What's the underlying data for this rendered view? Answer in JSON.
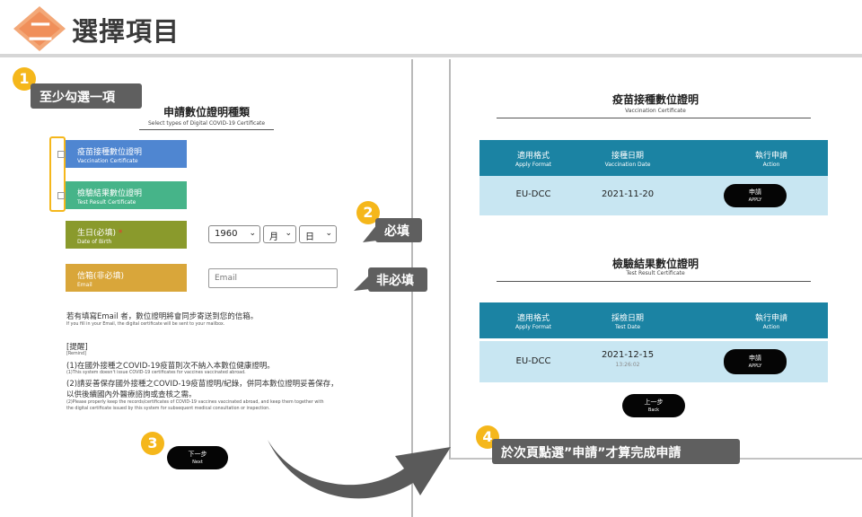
{
  "header": {
    "step_number": "二",
    "title": "選擇項目"
  },
  "form": {
    "title": "申請數位證明種類",
    "subtitle": "Select types of Digital COVID-19 Certificate",
    "options": [
      {
        "zh": "疫苗接種數位證明",
        "en": "Vaccination Certificate"
      },
      {
        "zh": "檢驗結果數位證明",
        "en": "Test Result Certificate"
      }
    ],
    "dob": {
      "zh": "生日(必填)",
      "required_mark": "*",
      "en": "Date of Birth",
      "year": "1960",
      "month": "月",
      "day": "日"
    },
    "email": {
      "zh": "信箱(非必填)",
      "en": "Email",
      "placeholder": "Email"
    },
    "notes": [
      {
        "zh": "若有填寫Email 者，數位證明將會同步寄送到您的信箱。",
        "en": "If you fill in your Email, the digital certificate will be sent to your mailbox."
      },
      {
        "zh": "[提醒]",
        "en": "[Remind]"
      },
      {
        "zh": "(1)在國外接種之COVID-19疫苗則次不納入本數位健康證明。",
        "en": "(1)This system doesn't issue COVID-19 certificates for vaccines vaccinated abroad."
      },
      {
        "zh": "(2)請妥善保存國外接種之COVID-19疫苗證明/紀錄，併同本數位證明妥善保存，",
        "zh2": "以供後續國內外醫療諮詢或查核之需。",
        "en": "(2)Please properly keep the records/certificates of COVID-19 vaccines vaccinated abroad, and keep them together with",
        "en2": "the digital certificate issued by this system for subsequent medical consultation or inspection."
      }
    ],
    "next_button": {
      "zh": "下一步",
      "en": "Next"
    }
  },
  "right": {
    "vaccination": {
      "title": "疫苗接種數位證明",
      "subtitle": "Vaccination Certificate",
      "headers": [
        {
          "zh": "適用格式",
          "en": "Apply Format"
        },
        {
          "zh": "接種日期",
          "en": "Vaccination Date"
        },
        {
          "zh": "執行申請",
          "en": "Action"
        }
      ],
      "row": {
        "format": "EU-DCC",
        "date": "2021-11-20"
      }
    },
    "test": {
      "title": "檢驗結果數位證明",
      "subtitle": "Test Result Certificate",
      "headers": [
        {
          "zh": "適用格式",
          "en": "Apply Format"
        },
        {
          "zh": "採檢日期",
          "en": "Test Date"
        },
        {
          "zh": "執行申請",
          "en": "Action"
        }
      ],
      "row": {
        "format": "EU-DCC",
        "date": "2021-12-15",
        "time": "13:26:02"
      }
    },
    "apply_button": {
      "zh": "申請",
      "en": "APPLY"
    },
    "back_button": {
      "zh": "上一步",
      "en": "Back"
    }
  },
  "callouts": [
    {
      "number": "1",
      "text": "至少勾選一項"
    },
    {
      "number": "2",
      "text": "必填"
    },
    {
      "number": "",
      "text": "非必填"
    },
    {
      "number": "3",
      "text": ""
    },
    {
      "number": "4",
      "text": "於次頁點選”申請”才算完成申請"
    }
  ],
  "colors": {
    "accent": "#f5b71b",
    "table_header": "#1b83a3",
    "table_row": "#c8e6f2",
    "callout_bg": "#5f5f5f"
  }
}
